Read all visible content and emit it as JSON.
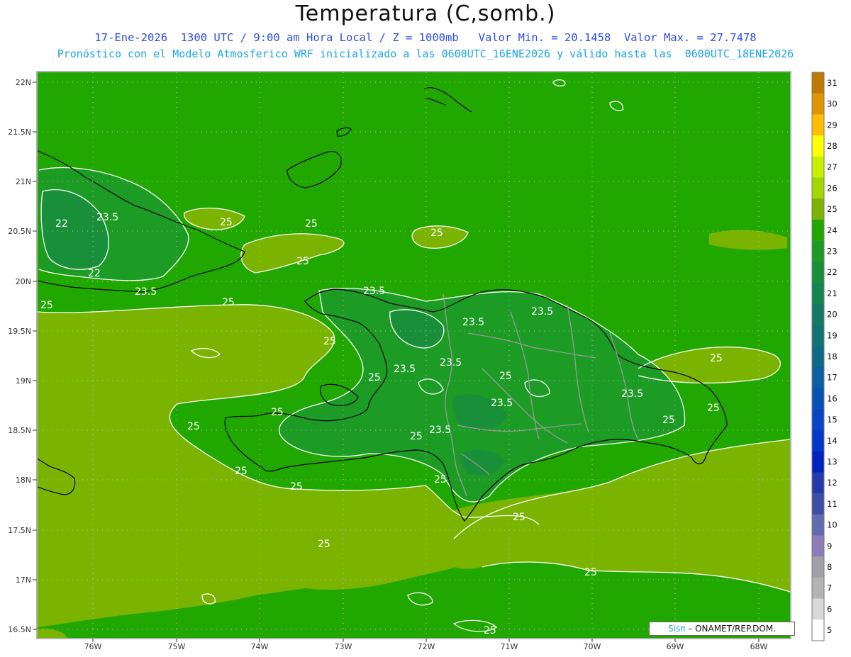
{
  "title": "Temperatura (C,somb.)",
  "subtitle1": "17-Ene-2026  1300 UTC / 9:00 am Hora Local / Z = 1000mb   Valor Min. = 20.1458  Valor Max. = 27.7478",
  "subtitle2": "Pronóstico con el Modelo Atmosferico WRF inicializado a las 0600UTC_16ENE2026 y válido hasta las  0600UTC_18ENE2026",
  "lat_labels": [
    "22N",
    "21.5N",
    "21N",
    "20.5N",
    "20N",
    "19.5N",
    "19N",
    "18.5N",
    "18N",
    "17.5N",
    "17N",
    "16.5N"
  ],
  "lon_labels": [
    "76W",
    "75W",
    "74W",
    "73W",
    "72W",
    "71W",
    "70W",
    "69W",
    "68W"
  ],
  "contour_labels": [
    "22",
    "23.5",
    "23.5",
    "22",
    "23.5",
    "25",
    "25",
    "25",
    "25",
    "25",
    "25",
    "23.5",
    "23.5",
    "23.5",
    "25",
    "25",
    "23.5",
    "25",
    "25",
    "23.5",
    "25",
    "25",
    "25",
    "25",
    "25",
    "23.5",
    "25",
    "23.5",
    "25",
    "25",
    "25",
    "25",
    "25",
    "25"
  ],
  "colorbar": {
    "labels": [
      "31",
      "30",
      "29",
      "28",
      "27",
      "26",
      "25",
      "24",
      "23",
      "22",
      "21",
      "20",
      "19",
      "18",
      "17",
      "16",
      "15",
      "14",
      "13",
      "12",
      "11",
      "10",
      "9",
      "8",
      "7",
      "6",
      "5"
    ],
    "colors": [
      "#c07a00",
      "#e09500",
      "#ffbf00",
      "#ffff00",
      "#c8f000",
      "#a2d700",
      "#7bb400",
      "#21a800",
      "#1c9c25",
      "#198f3a",
      "#168451",
      "#137a63",
      "#117274",
      "#0d6a86",
      "#0a60a0",
      "#0753b5",
      "#0547c4",
      "#0237cc",
      "#0023c0",
      "#2439ac",
      "#3b4ea8",
      "#5f6cae",
      "#8c7cb8",
      "#a0a0a8",
      "#b4b4b4",
      "#d8d8d8",
      "#ffffff"
    ]
  },
  "credit": {
    "brand": "Sisπ",
    "text": " – ONAMET/REP.DOM."
  },
  "colors": {
    "field_base": "#21a800",
    "field_low": "#1c9c25",
    "field_lower": "#198f3a",
    "field_warm": "#7bb400",
    "coast": "#000000",
    "border": "#999999",
    "contour": "#ffffff"
  }
}
